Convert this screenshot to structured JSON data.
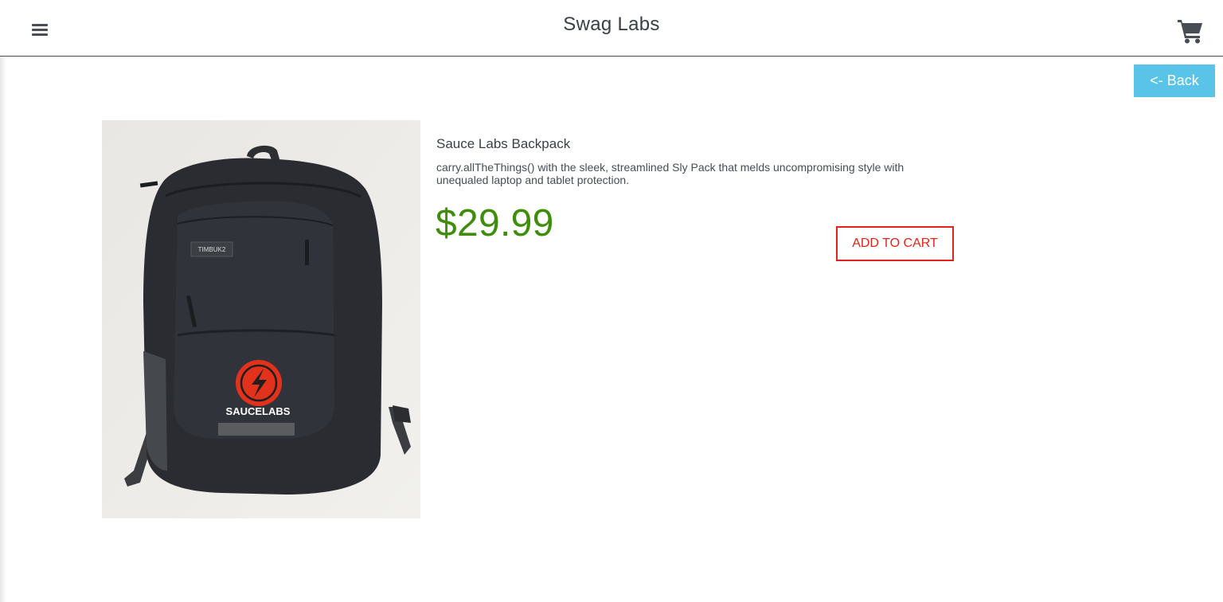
{
  "header": {
    "app_title": "Swag Labs",
    "menu_icon": "hamburger-menu-icon",
    "cart_icon": "shopping-cart-icon"
  },
  "navigation": {
    "back_label": "<- Back"
  },
  "product": {
    "name": "Sauce Labs Backpack",
    "description": "carry.allTheThings() with the sleek, streamlined Sly Pack that melds uncompromising style with unequaled laptop and tablet protection.",
    "price": "$29.99",
    "add_to_cart_label": "ADD TO CART",
    "image_alt": "Sauce Labs Backpack",
    "bag_tag_text": "TIMBUK2",
    "bag_logo_text": "SAUCELABS"
  },
  "colors": {
    "accent_back": "#5ac4e8",
    "price_green": "#3e8d0b",
    "add_to_cart_red": "#e2231a",
    "header_border": "#474c55"
  }
}
